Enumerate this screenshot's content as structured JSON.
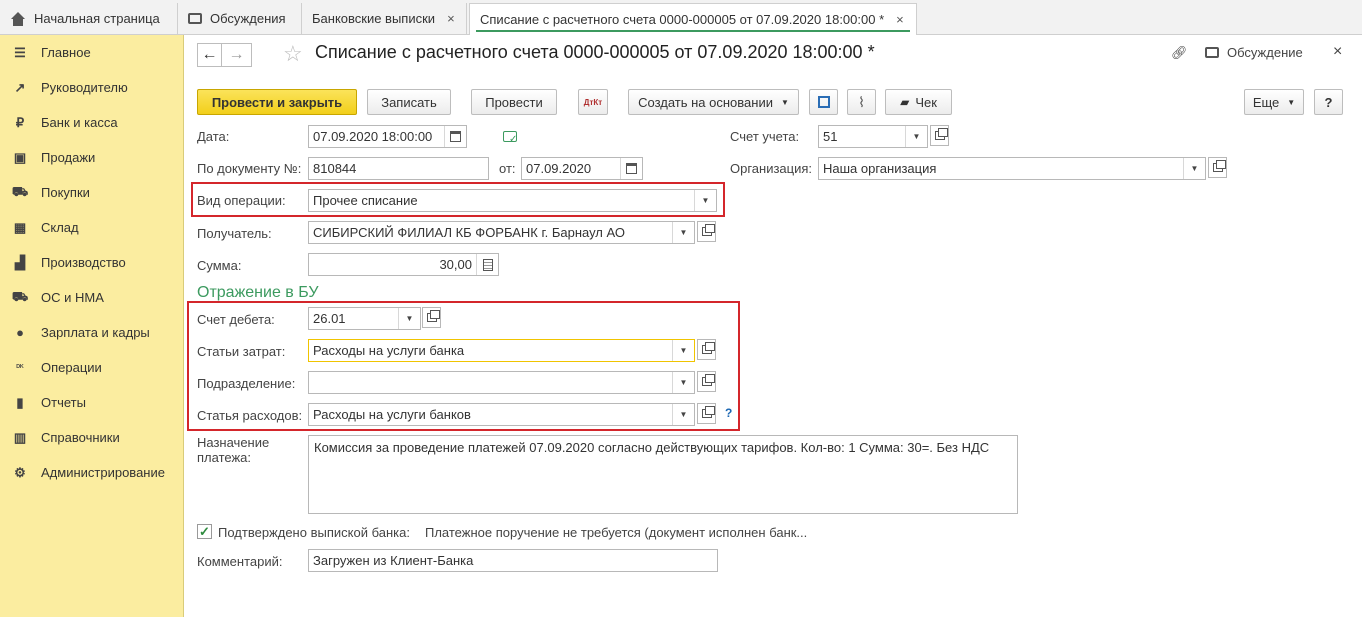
{
  "tabs": [
    {
      "label": "Начальная страница",
      "icon": "home-icon"
    },
    {
      "label": "Обсуждения",
      "icon": "discussion-icon"
    },
    {
      "label": "Банковские выписки",
      "close": "×"
    },
    {
      "label": "Списание с расчетного счета 0000-000005 от 07.09.2020 18:00:00 *",
      "close": "×",
      "active": true
    }
  ],
  "sidebar": {
    "items": [
      {
        "label": "Главное",
        "icon": "menu-icon",
        "glyph": "☰"
      },
      {
        "label": "Руководителю",
        "icon": "trend-icon",
        "glyph": "↗"
      },
      {
        "label": "Банк и касса",
        "icon": "ruble-icon",
        "glyph": "₽"
      },
      {
        "label": "Продажи",
        "icon": "bag-icon",
        "glyph": "▣"
      },
      {
        "label": "Покупки",
        "icon": "cart-icon",
        "glyph": "⛟"
      },
      {
        "label": "Склад",
        "icon": "warehouse-icon",
        "glyph": "▦"
      },
      {
        "label": "Производство",
        "icon": "factory-icon",
        "glyph": "▟"
      },
      {
        "label": "ОС и НМА",
        "icon": "truck-icon",
        "glyph": "⛟"
      },
      {
        "label": "Зарплата и кадры",
        "icon": "person-icon",
        "glyph": "●"
      },
      {
        "label": "Операции",
        "icon": "dt-kt-icon",
        "glyph": "ᴰᴷ"
      },
      {
        "label": "Отчеты",
        "icon": "bar-chart-icon",
        "glyph": "▮"
      },
      {
        "label": "Справочники",
        "icon": "books-icon",
        "glyph": "▥"
      },
      {
        "label": "Администрирование",
        "icon": "gear-icon",
        "glyph": "⚙"
      }
    ]
  },
  "header": {
    "back": "←",
    "forward": "→",
    "title": "Списание с расчетного счета 0000-000005 от 07.09.2020 18:00:00 *",
    "discussion": "Обсуждение",
    "close": "×"
  },
  "toolbar": {
    "post_close": "Провести и закрыть",
    "save": "Записать",
    "post": "Провести",
    "dt_kt": "ДтКт",
    "create_based": "Создать на основании",
    "check": "Чек",
    "more": "Еще",
    "help": "?"
  },
  "form": {
    "date_label": "Дата:",
    "date_value": "07.09.2020 18:00:00",
    "doc_num_label": "По документу №:",
    "doc_num_value": "810844",
    "from_label": "от:",
    "from_value": "07.09.2020",
    "account_label": "Счет учета:",
    "account_value": "51",
    "org_label": "Организация:",
    "org_value": "Наша организация",
    "op_type_label": "Вид операции:",
    "op_type_value": "Прочее списание",
    "recipient_label": "Получатель:",
    "recipient_value": "СИБИРСКИЙ ФИЛИАЛ КБ ФОРБАНК г. Барнаул АО",
    "sum_label": "Сумма:",
    "sum_value": "30,00",
    "section_title": "Отражение в БУ",
    "debit_label": "Счет дебета:",
    "debit_value": "26.01",
    "cost_items_label": "Статьи затрат:",
    "cost_items_value": "Расходы на услуги банка",
    "division_label": "Подразделение:",
    "division_value": "",
    "expense_label": "Статья расходов:",
    "expense_value": "Расходы на услуги банков",
    "expense_help": "?",
    "purpose_label_1": "Назначение",
    "purpose_label_2": "платежа:",
    "purpose_value": "Комиссия за проведение платежей 07.09.2020 согласно действующих тарифов.  Кол-во: 1 Сумма: 30=. Без НДС",
    "confirmed_label": "Подтверждено выпиской банка:",
    "confirmed_checked": true,
    "confirmed_note": "Платежное поручение не требуется (документ исполнен банк...",
    "comment_label": "Комментарий:",
    "comment_value": "Загружен из Клиент-Банка"
  },
  "colors": {
    "sidebar_bg": "#fbeda0",
    "primary_button": "#f2cf1a",
    "highlight_border": "#d4262b",
    "section_title": "#3c9a5f",
    "active_tab_underline": "#3c9a5f"
  }
}
